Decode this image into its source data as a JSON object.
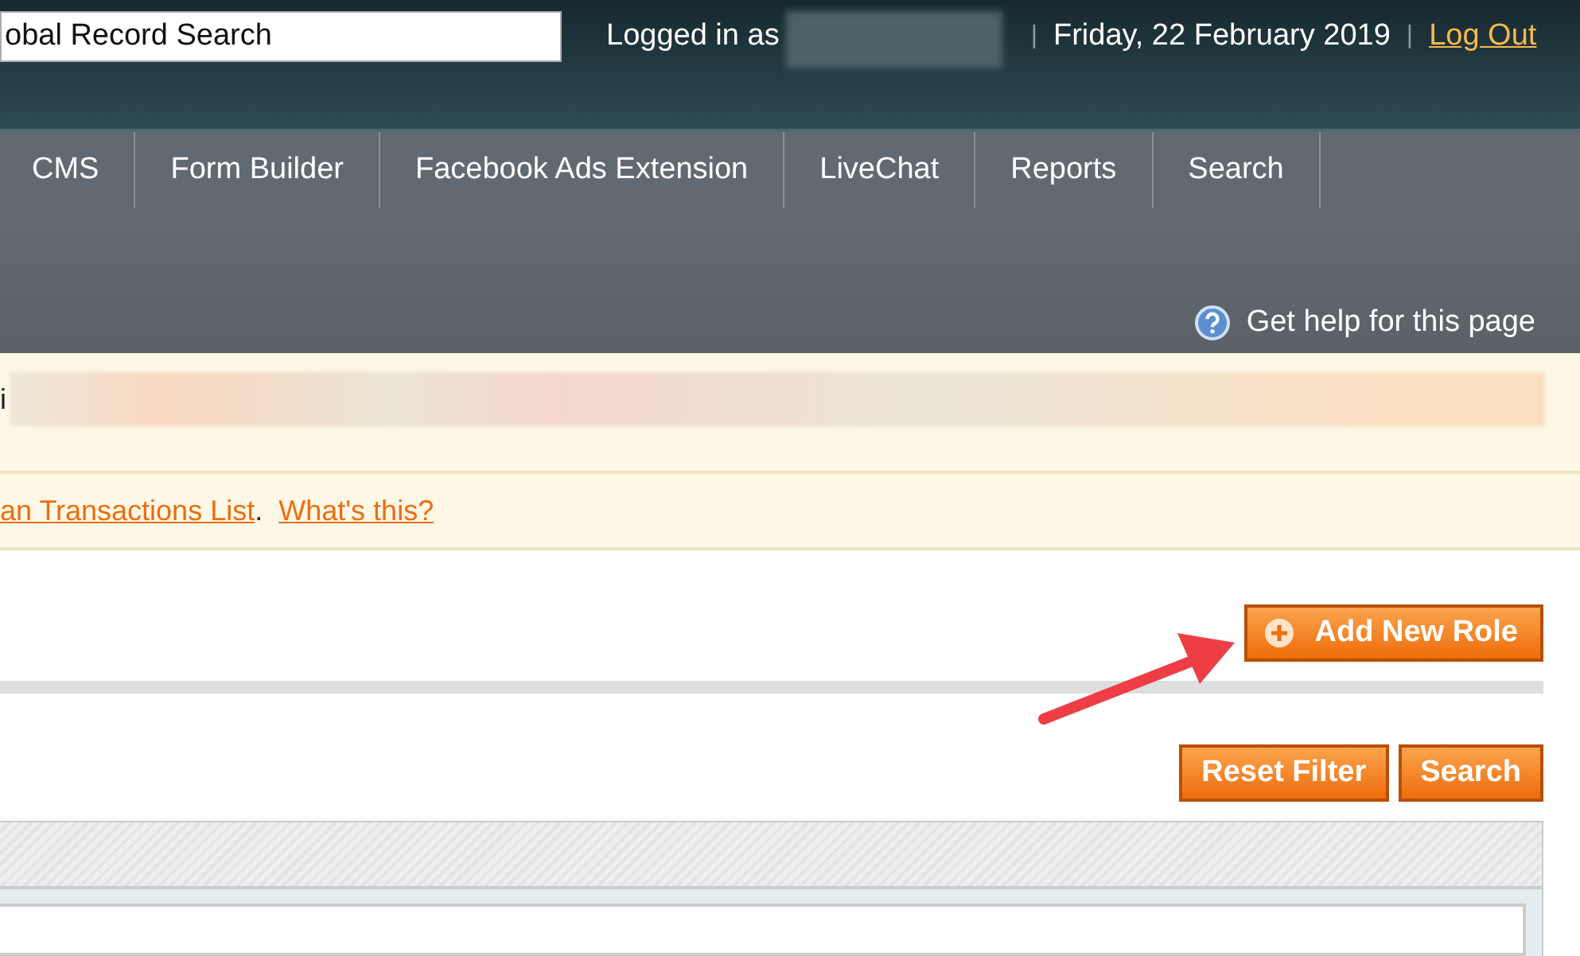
{
  "header": {
    "search": {
      "value": "obal Record Search"
    },
    "logged_in_label": "Logged in as",
    "separators": [
      "|",
      "|"
    ],
    "date": "Friday, 22 February 2019",
    "logout": "Log Out"
  },
  "nav": {
    "items": [
      {
        "label": "CMS"
      },
      {
        "label": "Form Builder"
      },
      {
        "label": "Facebook Ads Extension"
      },
      {
        "label": "LiveChat"
      },
      {
        "label": "Reports"
      },
      {
        "label": "Search"
      }
    ]
  },
  "help_link": "Get help for this page",
  "notices": [
    {
      "kind": "blurred",
      "text": "i"
    },
    {
      "kind": "links",
      "link": "an Transactions List",
      "separator": ".",
      "help": "What's this?"
    }
  ],
  "add_button": "Add New Role",
  "grid": {
    "buttons": [
      "Reset Filter",
      "Search"
    ]
  }
}
